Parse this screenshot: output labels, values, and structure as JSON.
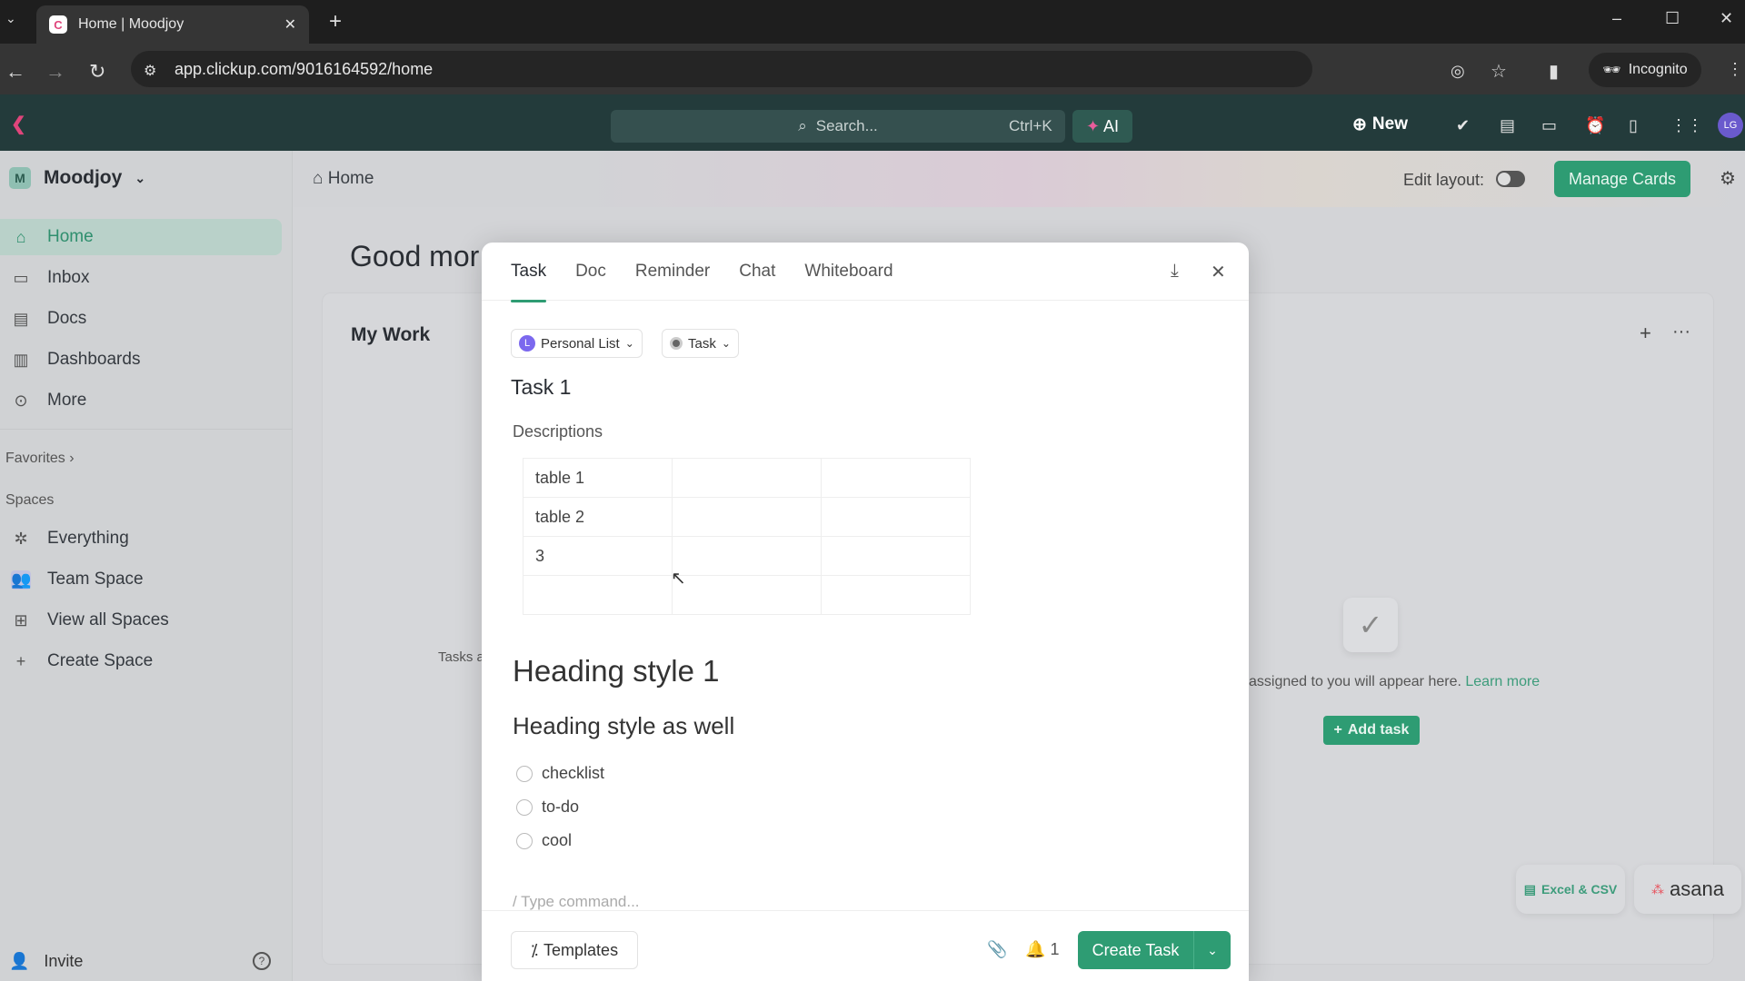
{
  "browser": {
    "tab_title": "Home | Moodjoy",
    "url": "app.clickup.com/9016164592/home",
    "incognito_label": "Incognito"
  },
  "header": {
    "search_placeholder": "Search...",
    "search_shortcut": "Ctrl+K",
    "ai_label": "AI",
    "new_label": "New",
    "avatar_initials": "LG"
  },
  "sidebar": {
    "workspace": "Moodjoy",
    "workspace_initial": "M",
    "nav": [
      {
        "label": "Home",
        "icon": "home-icon"
      },
      {
        "label": "Inbox",
        "icon": "inbox-icon"
      },
      {
        "label": "Docs",
        "icon": "doc-icon"
      },
      {
        "label": "Dashboards",
        "icon": "dashboard-icon"
      },
      {
        "label": "More",
        "icon": "more-icon"
      }
    ],
    "favorites_label": "Favorites",
    "spaces_label": "Spaces",
    "spaces": [
      {
        "label": "Everything"
      },
      {
        "label": "Team Space"
      },
      {
        "label": "View all Spaces"
      },
      {
        "label": "Create Space"
      }
    ],
    "invite_label": "Invite"
  },
  "main": {
    "breadcrumb": "Home",
    "edit_layout_label": "Edit layout:",
    "manage_cards_label": "Manage Cards",
    "greeting": "Good mor",
    "card_title": "My Work",
    "tasks_text": "Tasks a",
    "empty_text": "assigned to you will appear here.",
    "learn_more": "Learn more",
    "add_task_label": "Add task",
    "import_excel": "Excel & CSV",
    "import_asana": "asana"
  },
  "modal": {
    "tabs": [
      "Task",
      "Doc",
      "Reminder",
      "Chat",
      "Whiteboard"
    ],
    "active_tab": "Task",
    "list_chip": "Personal List",
    "list_initial": "L",
    "type_chip": "Task",
    "task_name": "Task 1",
    "description_label": "Descriptions",
    "table": [
      [
        "table 1",
        "",
        ""
      ],
      [
        "table 2",
        "",
        ""
      ],
      [
        "3",
        "",
        ""
      ],
      [
        "",
        "",
        ""
      ]
    ],
    "heading1": "Heading style 1",
    "heading2": "Heading style as well",
    "checklist": [
      "checklist",
      "to-do",
      "cool"
    ],
    "command_placeholder": "/ Type command...",
    "templates_label": "Templates",
    "reminder_count": "1",
    "create_label": "Create Task"
  },
  "colors": {
    "accent": "#2e9c73",
    "header_bg": "#233b3b",
    "list_badge": "#7b68ee"
  }
}
